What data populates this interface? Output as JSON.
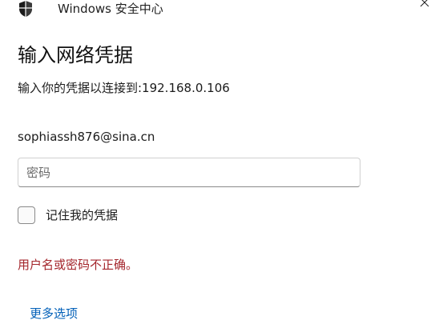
{
  "titlebar": {
    "app_title": "Windows 安全中心",
    "icon": "shield-icon",
    "close_icon": "close-icon"
  },
  "dialog": {
    "heading": "输入网络凭据",
    "subtitle": "输入你的凭据以连接到:192.168.0.106",
    "username": "sophiassh876@sina.cn",
    "password": {
      "value": "",
      "placeholder": "密码"
    },
    "remember": {
      "label": "记住我的凭据",
      "checked": false
    },
    "error": "用户名或密码不正确。",
    "more_options": "更多选项"
  },
  "colors": {
    "error": "#a4262c",
    "link": "#005fb8",
    "background": "#ffffff"
  }
}
